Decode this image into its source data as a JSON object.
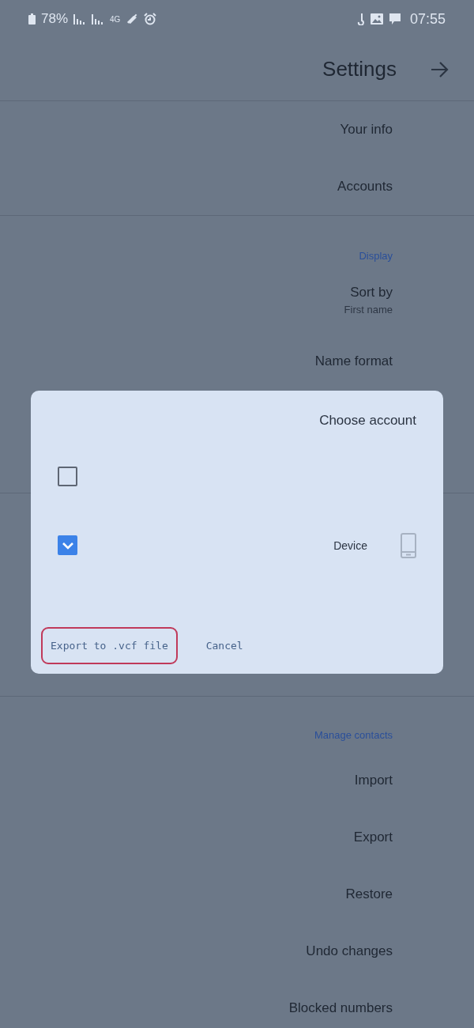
{
  "status_bar": {
    "battery": "78%",
    "network": "4G",
    "time": "07:55"
  },
  "header": {
    "title": "Settings"
  },
  "sections": [
    {
      "items": [
        {
          "title": "Your info"
        },
        {
          "title": "Accounts"
        }
      ]
    },
    {
      "header": "Display",
      "items": [
        {
          "title": "Sort by",
          "subtitle": "First name"
        },
        {
          "title": "Name format"
        }
      ]
    },
    {
      "header": "Manage contacts",
      "items": [
        {
          "title": "Import"
        },
        {
          "title": "Export"
        },
        {
          "title": "Restore"
        },
        {
          "title": "Undo changes"
        },
        {
          "title": "Blocked numbers"
        }
      ]
    }
  ],
  "dialog": {
    "title": "Choose account",
    "accounts": [
      {
        "checked": false
      },
      {
        "label": "Device",
        "checked": true
      }
    ],
    "buttons": [
      {
        "label": "Export to .vcf file",
        "highlighted": true
      },
      {
        "label": "Cancel",
        "highlighted": false
      }
    ]
  }
}
